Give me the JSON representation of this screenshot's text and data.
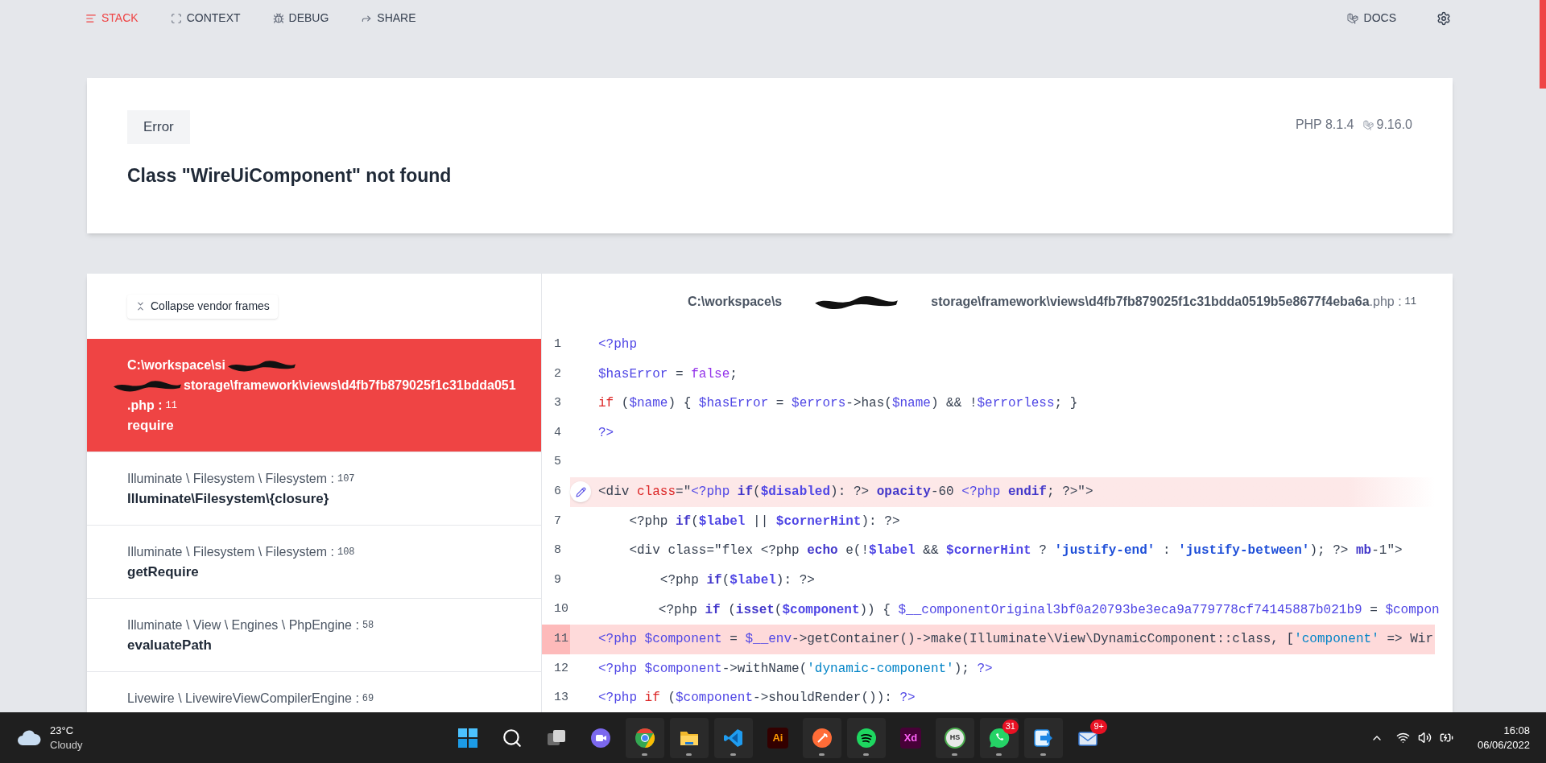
{
  "nav": {
    "tabs": [
      {
        "label": "STACK",
        "selected": true
      },
      {
        "label": "CONTEXT",
        "selected": false
      },
      {
        "label": "DEBUG",
        "selected": false
      },
      {
        "label": "SHARE",
        "selected": false
      }
    ],
    "docs": "DOCS"
  },
  "error": {
    "badge": "Error",
    "message": "Class \"WireUiComponent\" not found",
    "php_version": "PHP 8.1.4",
    "laravel_version": "9.16.0"
  },
  "frames": {
    "collapse_button": "Collapse vendor frames",
    "items": [
      {
        "selected": true,
        "path_lines": [
          [
            {
              "kind": "text",
              "text": "C:\\workspace\\si"
            },
            {
              "kind": "redaction"
            }
          ],
          [
            {
              "kind": "redaction"
            },
            {
              "kind": "text",
              "text": "storage\\framework\\views\\d4fb7fb879025f1c31bdda051"
            }
          ],
          [
            {
              "kind": "text",
              "text": ".php :"
            },
            {
              "kind": "line",
              "text": "11"
            }
          ]
        ],
        "method": "require"
      },
      {
        "selected": false,
        "path_lines": [
          [
            {
              "kind": "text",
              "text": "Illuminate \\ Filesystem \\ Filesystem :"
            },
            {
              "kind": "line",
              "text": "107"
            }
          ]
        ],
        "method": "Illuminate\\Filesystem\\{closure}"
      },
      {
        "selected": false,
        "path_lines": [
          [
            {
              "kind": "text",
              "text": "Illuminate \\ Filesystem \\ Filesystem :"
            },
            {
              "kind": "line",
              "text": "108"
            }
          ]
        ],
        "method": "getRequire"
      },
      {
        "selected": false,
        "path_lines": [
          [
            {
              "kind": "text",
              "text": "Illuminate \\ View \\ Engines \\ PhpEngine :"
            },
            {
              "kind": "line",
              "text": "58"
            }
          ]
        ],
        "method": "evaluatePath"
      },
      {
        "selected": false,
        "path_lines": [
          [
            {
              "kind": "text",
              "text": "Livewire \\ LivewireViewCompilerEngine :"
            },
            {
              "kind": "line",
              "text": "69"
            }
          ]
        ]
      }
    ]
  },
  "code": {
    "file": [
      {
        "kind": "text",
        "text": "C:\\workspace\\s"
      },
      {
        "kind": "redaction"
      },
      {
        "kind": "text",
        "text": "storage\\framework\\views\\d4fb7fb879025f1c31bdda0519b5e8677f4eba6a"
      },
      {
        "kind": "ext",
        "text": ".php :"
      },
      {
        "kind": "line",
        "text": "11"
      }
    ],
    "lines": [
      {
        "number": "1",
        "kind": "normal",
        "tokens": [
          {
            "kind": "tag",
            "text": "<?php"
          }
        ]
      },
      {
        "number": "2",
        "kind": "normal",
        "tokens": [
          {
            "kind": "var",
            "text": "$hasError"
          },
          {
            "kind": "plain",
            "text": " = "
          },
          {
            "kind": "literal",
            "text": "false"
          },
          {
            "kind": "plain",
            "text": ";"
          }
        ]
      },
      {
        "number": "3",
        "kind": "normal",
        "tokens": [
          {
            "kind": "kw_red",
            "text": "if"
          },
          {
            "kind": "plain",
            "text": " ("
          },
          {
            "kind": "var",
            "text": "$name"
          },
          {
            "kind": "plain",
            "text": ") { "
          },
          {
            "kind": "var",
            "text": "$hasError"
          },
          {
            "kind": "plain",
            "text": " = "
          },
          {
            "kind": "var",
            "text": "$errors"
          },
          {
            "kind": "plain",
            "text": "->has("
          },
          {
            "kind": "var",
            "text": "$name"
          },
          {
            "kind": "plain",
            "text": ") && !"
          },
          {
            "kind": "var",
            "text": "$errorless"
          },
          {
            "kind": "plain",
            "text": "; }"
          }
        ]
      },
      {
        "number": "4",
        "kind": "normal",
        "tokens": [
          {
            "kind": "tag",
            "text": "?>"
          }
        ]
      },
      {
        "number": "5",
        "kind": "normal"
      },
      {
        "number": "6",
        "kind": "editable",
        "tokens": [
          {
            "kind": "plain",
            "text": "<div "
          },
          {
            "kind": "kw_red",
            "text": "class"
          },
          {
            "kind": "plain",
            "text": "=\""
          },
          {
            "kind": "tag",
            "text": "<?php "
          },
          {
            "kind": "kw_bold",
            "text": "if"
          },
          {
            "kind": "plain",
            "text": "("
          },
          {
            "kind": "var_bold",
            "text": "$disabled"
          },
          {
            "kind": "plain",
            "text": "): ?> "
          },
          {
            "kind": "kw_bold",
            "text": "opacity"
          },
          {
            "kind": "plain",
            "text": "-60 "
          },
          {
            "kind": "tag",
            "text": "<?php "
          },
          {
            "kind": "kw_bold",
            "text": "endif"
          },
          {
            "kind": "plain",
            "text": "; ?>\">"
          }
        ]
      },
      {
        "number": "7",
        "kind": "normal",
        "tokens": [
          {
            "kind": "plain",
            "text": "    <?php "
          },
          {
            "kind": "kw_bold",
            "text": "if"
          },
          {
            "kind": "plain",
            "text": "("
          },
          {
            "kind": "var_bold",
            "text": "$label"
          },
          {
            "kind": "plain",
            "text": " || "
          },
          {
            "kind": "var_bold",
            "text": "$cornerHint"
          },
          {
            "kind": "plain",
            "text": "): ?>"
          }
        ]
      },
      {
        "number": "8",
        "kind": "normal",
        "tokens": [
          {
            "kind": "plain",
            "text": "    <div class=\"flex <?php "
          },
          {
            "kind": "kw_bold",
            "text": "echo"
          },
          {
            "kind": "plain",
            "text": " e(!"
          },
          {
            "kind": "var_bold",
            "text": "$label"
          },
          {
            "kind": "plain",
            "text": " && "
          },
          {
            "kind": "var_bold",
            "text": "$cornerHint"
          },
          {
            "kind": "plain",
            "text": " ? "
          },
          {
            "kind": "string_bold",
            "text": "'justify-end'"
          },
          {
            "kind": "plain",
            "text": " : "
          },
          {
            "kind": "string_bold",
            "text": "'justify-between'"
          },
          {
            "kind": "plain",
            "text": "); ?> "
          },
          {
            "kind": "kw_bold",
            "text": "mb"
          },
          {
            "kind": "plain",
            "text": "-1\">"
          }
        ]
      },
      {
        "number": "9",
        "kind": "normal",
        "tokens": [
          {
            "kind": "plain",
            "text": "        <?php "
          },
          {
            "kind": "kw_bold",
            "text": "if"
          },
          {
            "kind": "plain",
            "text": "("
          },
          {
            "kind": "var_bold",
            "text": "$label"
          },
          {
            "kind": "plain",
            "text": "): ?>"
          }
        ]
      },
      {
        "number": "10",
        "kind": "normal",
        "tokens": [
          {
            "kind": "plain",
            "text": "        <?php "
          },
          {
            "kind": "kw_bold",
            "text": "if"
          },
          {
            "kind": "plain",
            "text": " ("
          },
          {
            "kind": "kw_bold",
            "text": "isset"
          },
          {
            "kind": "plain",
            "text": "("
          },
          {
            "kind": "var_bold",
            "text": "$component"
          },
          {
            "kind": "plain",
            "text": ")) { "
          },
          {
            "kind": "var",
            "text": "$__componentOriginal3bf0a20793be3eca9a779778cf74145887b021b9"
          },
          {
            "kind": "plain",
            "text": " = "
          },
          {
            "kind": "var",
            "text": "$compon"
          }
        ]
      },
      {
        "number": "11",
        "kind": "error",
        "tokens": [
          {
            "kind": "tag",
            "text": "<?php "
          },
          {
            "kind": "var",
            "text": "$component"
          },
          {
            "kind": "plain",
            "text": " = "
          },
          {
            "kind": "var",
            "text": "$__env"
          },
          {
            "kind": "plain",
            "text": "->getContainer()->make(Illuminate\\View\\DynamicComponent::class, ["
          },
          {
            "kind": "string",
            "text": "'component'"
          },
          {
            "kind": "plain",
            "text": " => Wir"
          }
        ]
      },
      {
        "number": "12",
        "kind": "normal",
        "tokens": [
          {
            "kind": "tag",
            "text": "<?php "
          },
          {
            "kind": "var",
            "text": "$component"
          },
          {
            "kind": "plain",
            "text": "->withName("
          },
          {
            "kind": "string",
            "text": "'dynamic-component'"
          },
          {
            "kind": "plain",
            "text": "); "
          },
          {
            "kind": "tag",
            "text": "?>"
          }
        ]
      },
      {
        "number": "13",
        "kind": "normal",
        "tokens": [
          {
            "kind": "tag",
            "text": "<?php "
          },
          {
            "kind": "kw_red",
            "text": "if"
          },
          {
            "kind": "plain",
            "text": " ("
          },
          {
            "kind": "var",
            "text": "$component"
          },
          {
            "kind": "plain",
            "text": "->shouldRender()): "
          },
          {
            "kind": "tag",
            "text": "?>"
          }
        ]
      }
    ]
  },
  "taskbar": {
    "weather": {
      "temperature": "23°C",
      "condition": "Cloudy"
    },
    "apps": [
      {
        "kind": "windows",
        "running": false
      },
      {
        "kind": "search",
        "running": false
      },
      {
        "kind": "taskview",
        "running": false
      },
      {
        "kind": "teams",
        "running": false
      },
      {
        "kind": "chrome",
        "running": true
      },
      {
        "kind": "folder",
        "running": true
      },
      {
        "kind": "vscode",
        "running": true
      },
      {
        "kind": "illustrator",
        "label": "Ai",
        "running": false
      },
      {
        "kind": "postman",
        "running": true
      },
      {
        "kind": "spotify",
        "running": true
      },
      {
        "kind": "xd",
        "label": "Xd",
        "running": false
      },
      {
        "kind": "hs",
        "label": "HS",
        "running": true
      },
      {
        "kind": "whatsapp",
        "badge": "31",
        "running": true
      },
      {
        "kind": "arrowapp",
        "running": true
      },
      {
        "kind": "mail",
        "badge": "9+",
        "running": false
      }
    ],
    "time": "16:08",
    "date": "06/06/2022"
  }
}
